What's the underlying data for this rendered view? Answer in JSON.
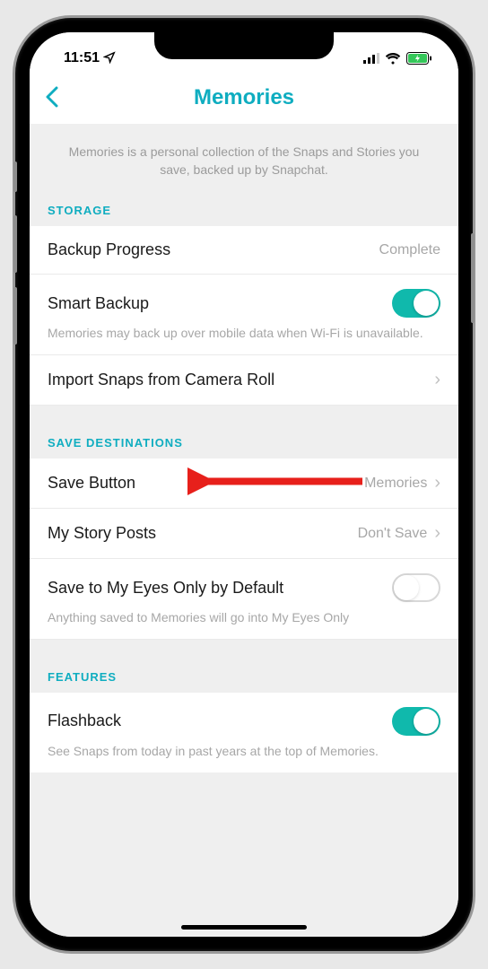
{
  "status_bar": {
    "time": "11:51"
  },
  "header": {
    "title": "Memories"
  },
  "description": "Memories is a personal collection of the Snaps and Stories you save, backed up by Snapchat.",
  "sections": {
    "storage": {
      "header": "STORAGE",
      "backup_progress": {
        "label": "Backup Progress",
        "value": "Complete"
      },
      "smart_backup": {
        "label": "Smart Backup",
        "helper": "Memories may back up over mobile data when Wi-Fi is unavailable."
      },
      "import": {
        "label": "Import Snaps from Camera Roll"
      }
    },
    "save_destinations": {
      "header": "SAVE DESTINATIONS",
      "save_button": {
        "label": "Save Button",
        "value": "Memories"
      },
      "my_story_posts": {
        "label": "My Story Posts",
        "value": "Don't Save"
      },
      "save_eyes_only": {
        "label": "Save to My Eyes Only by Default",
        "helper": "Anything saved to Memories will go into My Eyes Only"
      }
    },
    "features": {
      "header": "FEATURES",
      "flashback": {
        "label": "Flashback",
        "helper": "See Snaps from today in past years at the top of Memories."
      }
    }
  }
}
